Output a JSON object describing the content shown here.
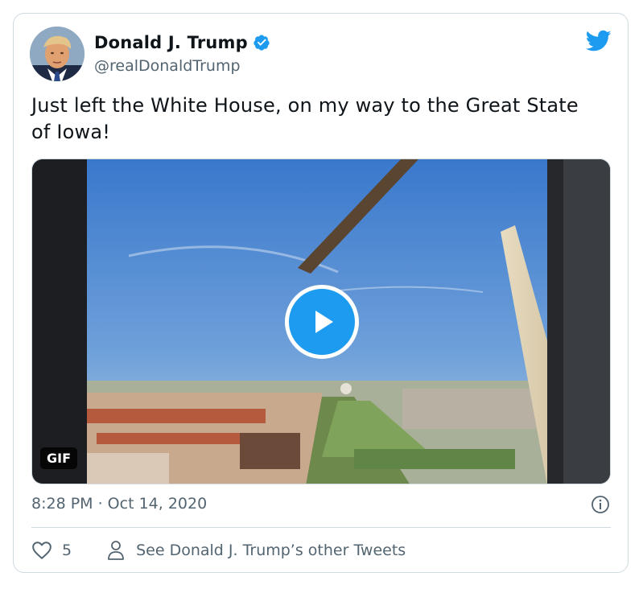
{
  "author": {
    "display_name": "Donald J. Trump",
    "handle": "@realDonaldTrump",
    "verified": true
  },
  "tweet": {
    "text": "Just left the White House, on my way to the Great State of Iowa!",
    "timestamp": "8:28 PM · Oct 14, 2020",
    "media": {
      "type": "gif",
      "badge": "GIF"
    }
  },
  "actions": {
    "like_count": "5",
    "other_tweets_label": "See Donald J. Trump’s other Tweets"
  },
  "colors": {
    "accent": "#1d9bf0",
    "text_primary": "#0f1419",
    "text_secondary": "#536471",
    "border": "#cfd9de"
  },
  "icons": [
    "twitter-bird-icon",
    "verified-badge-icon",
    "play-icon",
    "info-icon",
    "heart-icon",
    "person-icon"
  ]
}
